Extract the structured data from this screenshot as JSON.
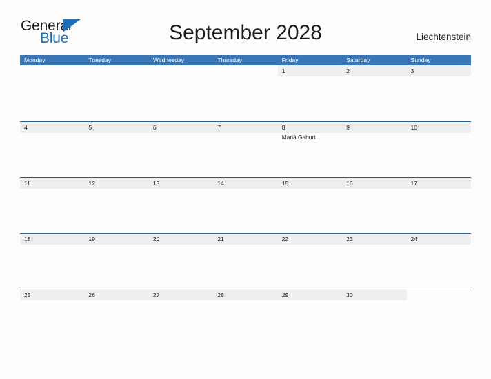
{
  "logo": {
    "text_primary": "General",
    "text_secondary": "Blue",
    "primary_color": "#1a1a1a",
    "secondary_color": "#1f70b8",
    "triangle_color": "#1f70b8"
  },
  "header": {
    "title": "September 2028",
    "region": "Liechtenstein"
  },
  "theme": {
    "header_bar_color": "#3a75b5",
    "row_divider_color": "#2b6199",
    "day_band_color": "#efefef",
    "page_background": "#fdfdfd",
    "text_color": "#1c1c1c"
  },
  "calendar": {
    "month": "September",
    "year": "2028",
    "weekday_headers": [
      "Monday",
      "Tuesday",
      "Wednesday",
      "Thursday",
      "Friday",
      "Saturday",
      "Sunday"
    ],
    "weeks": [
      [
        {
          "day": "",
          "events": []
        },
        {
          "day": "",
          "events": []
        },
        {
          "day": "",
          "events": []
        },
        {
          "day": "",
          "events": []
        },
        {
          "day": "1",
          "events": []
        },
        {
          "day": "2",
          "events": []
        },
        {
          "day": "3",
          "events": []
        }
      ],
      [
        {
          "day": "4",
          "events": []
        },
        {
          "day": "5",
          "events": []
        },
        {
          "day": "6",
          "events": []
        },
        {
          "day": "7",
          "events": []
        },
        {
          "day": "8",
          "events": [
            "Mariä Geburt"
          ]
        },
        {
          "day": "9",
          "events": []
        },
        {
          "day": "10",
          "events": []
        }
      ],
      [
        {
          "day": "11",
          "events": []
        },
        {
          "day": "12",
          "events": []
        },
        {
          "day": "13",
          "events": []
        },
        {
          "day": "14",
          "events": []
        },
        {
          "day": "15",
          "events": []
        },
        {
          "day": "16",
          "events": []
        },
        {
          "day": "17",
          "events": []
        }
      ],
      [
        {
          "day": "18",
          "events": []
        },
        {
          "day": "19",
          "events": []
        },
        {
          "day": "20",
          "events": []
        },
        {
          "day": "21",
          "events": []
        },
        {
          "day": "22",
          "events": []
        },
        {
          "day": "23",
          "events": []
        },
        {
          "day": "24",
          "events": []
        }
      ],
      [
        {
          "day": "25",
          "events": []
        },
        {
          "day": "26",
          "events": []
        },
        {
          "day": "27",
          "events": []
        },
        {
          "day": "28",
          "events": []
        },
        {
          "day": "29",
          "events": []
        },
        {
          "day": "30",
          "events": []
        },
        {
          "day": "",
          "events": []
        }
      ]
    ]
  }
}
